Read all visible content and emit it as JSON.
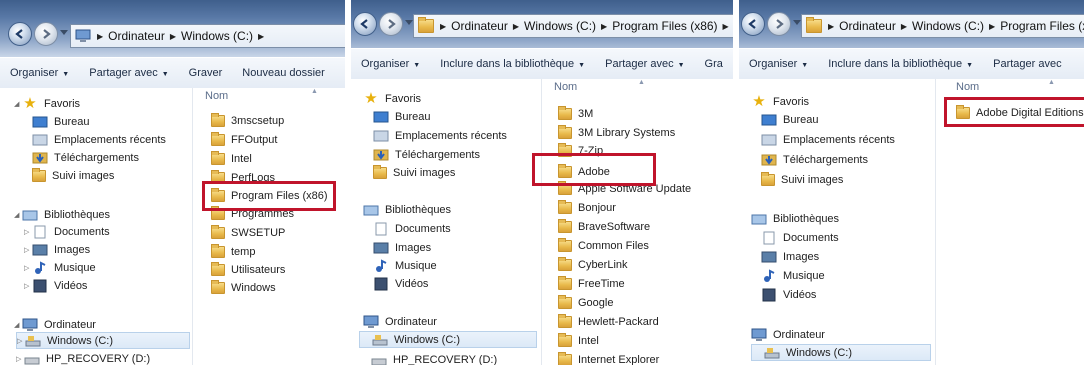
{
  "panel1": {
    "address": [
      "Ordinateur",
      "Windows (C:)"
    ],
    "toolbar": [
      "Organiser",
      "Partager avec",
      "Graver",
      "Nouveau dossier"
    ],
    "nav": {
      "favoris": "Favoris",
      "favoris_items": [
        "Bureau",
        "Emplacements récents",
        "Téléchargements",
        "Suivi images"
      ],
      "bibliotheques": "Bibliothèques",
      "biblio_items": [
        "Documents",
        "Images",
        "Musique",
        "Vidéos"
      ],
      "ordinateur": "Ordinateur",
      "ordi_items": [
        "Windows (C:)",
        "HP_RECOVERY (D:)"
      ]
    },
    "column": "Nom",
    "files": [
      "3mscsetup",
      "FFOutput",
      "Intel",
      "PerfLogs",
      "Program Files (x86)",
      "Programmes",
      "SWSETUP",
      "temp",
      "Utilisateurs",
      "Windows"
    ]
  },
  "panel2": {
    "address": [
      "Ordinateur",
      "Windows (C:)",
      "Program Files (x86)"
    ],
    "toolbar": [
      "Organiser",
      "Inclure dans la bibliothèque",
      "Partager avec",
      "Gra"
    ],
    "nav": {
      "favoris": "Favoris",
      "favoris_items": [
        "Bureau",
        "Emplacements récents",
        "Téléchargements",
        "Suivi images"
      ],
      "bibliotheques": "Bibliothèques",
      "biblio_items": [
        "Documents",
        "Images",
        "Musique",
        "Vidéos"
      ],
      "ordinateur": "Ordinateur",
      "ordi_items": [
        "Windows (C:)",
        "HP_RECOVERY (D:)"
      ]
    },
    "column": "Nom",
    "files": [
      "3M",
      "3M Library Systems",
      "7-Zip",
      "Adobe",
      "Apple Software Update",
      "Bonjour",
      "BraveSoftware",
      "Common Files",
      "CyberLink",
      "FreeTime",
      "Google",
      "Hewlett-Packard",
      "Intel",
      "Internet Explorer"
    ]
  },
  "panel3": {
    "address": [
      "Ordinateur",
      "Windows (C:)",
      "Program Files (x"
    ],
    "toolbar": [
      "Organiser",
      "Inclure dans la bibliothèque",
      "Partager avec"
    ],
    "nav": {
      "favoris": "Favoris",
      "favoris_items": [
        "Bureau",
        "Emplacements récents",
        "Téléchargements",
        "Suivi images"
      ],
      "bibliotheques": "Bibliothèques",
      "biblio_items": [
        "Documents",
        "Images",
        "Musique",
        "Vidéos"
      ],
      "ordinateur": "Ordinateur",
      "ordi_items": [
        "Windows (C:)"
      ]
    },
    "column": "Nom",
    "files": [
      "Adobe Digital Editions"
    ]
  },
  "colors": {
    "highlight": "#c0142b",
    "folder": "#e8b94a",
    "titlebar": "#5878a6"
  },
  "icons": [
    "back-icon",
    "forward-icon",
    "folder-icon",
    "star-icon",
    "library-icon",
    "computer-icon",
    "drive-icon"
  ]
}
